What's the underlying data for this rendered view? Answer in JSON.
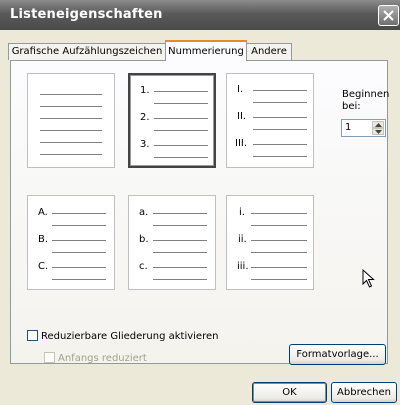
{
  "window": {
    "title": "Listeneigenschaften"
  },
  "tabs": [
    {
      "label": "Grafische Aufzählungszeichen",
      "active": false
    },
    {
      "label": "Nummerierung",
      "active": true
    },
    {
      "label": "Andere",
      "active": false
    }
  ],
  "previews": {
    "none": {
      "markers": []
    },
    "arabic": {
      "markers": [
        "1.",
        "2.",
        "3."
      ]
    },
    "roman_upper": {
      "markers": [
        "I.",
        "II.",
        "III."
      ]
    },
    "alpha_upper": {
      "markers": [
        "A.",
        "B.",
        "C."
      ]
    },
    "alpha_lower": {
      "markers": [
        "a.",
        "b.",
        "c."
      ]
    },
    "roman_lower": {
      "markers": [
        "i.",
        "ii.",
        "iii."
      ]
    },
    "selected": "arabic"
  },
  "start_at": {
    "label": "Beginnen bei:",
    "value": "1"
  },
  "options": {
    "collapsible_label": "Reduzierbare Gliederung aktivieren",
    "collapsible_checked": false,
    "initially_collapsed_label": "Anfangs reduziert",
    "initially_collapsed_checked": false,
    "initially_collapsed_enabled": false
  },
  "buttons": {
    "style_sheet": "Formatvorlage...",
    "ok": "OK",
    "cancel": "Abbrechen"
  },
  "icons": {
    "close": "close-icon",
    "spin_up": "arrow-up-icon",
    "spin_down": "arrow-down-icon",
    "cursor": "mouse-pointer-icon"
  }
}
